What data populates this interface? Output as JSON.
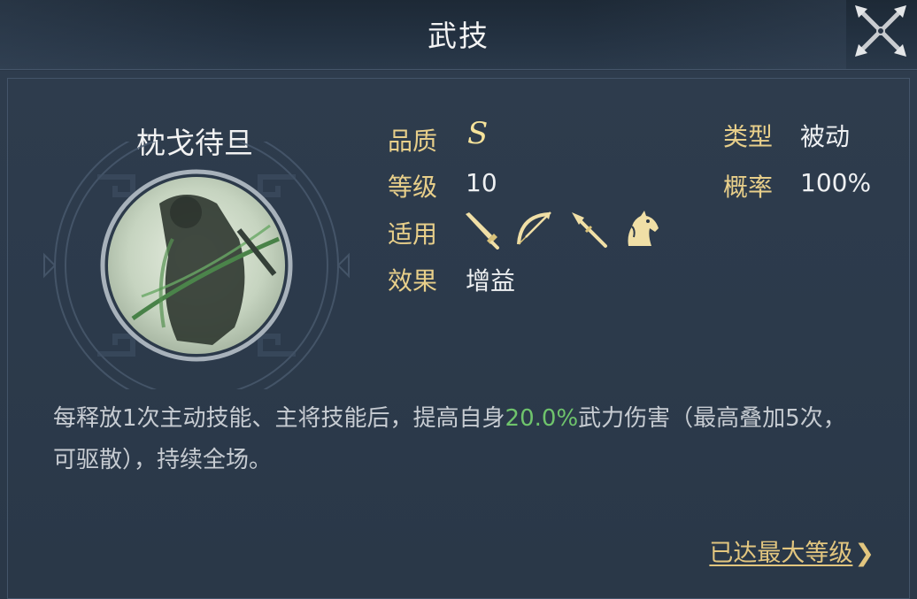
{
  "header": {
    "title": "武技"
  },
  "skill": {
    "name": "枕戈待旦",
    "quality_label": "品质",
    "quality_value": "S",
    "level_label": "等级",
    "level_value": "10",
    "applies_label": "适用",
    "applies_icons": [
      "sword-icon",
      "bow-icon",
      "spear-icon",
      "horse-icon"
    ],
    "effect_label": "效果",
    "effect_value": "增益",
    "type_label": "类型",
    "type_value": "被动",
    "chance_label": "概率",
    "chance_value": "100%"
  },
  "description": {
    "part1": "每释放1次主动技能、主将技能后，提高自身",
    "highlight": "20.0%",
    "part2": "武力伤害（最高叠加5次，可驱散），持续全场。",
    "highlight_color": "#6fc46c"
  },
  "footer": {
    "max_level_label": "已达最大等级",
    "arrow": "❯"
  },
  "colors": {
    "label_gold": "#e8cf8a",
    "background": "#2b3848"
  }
}
